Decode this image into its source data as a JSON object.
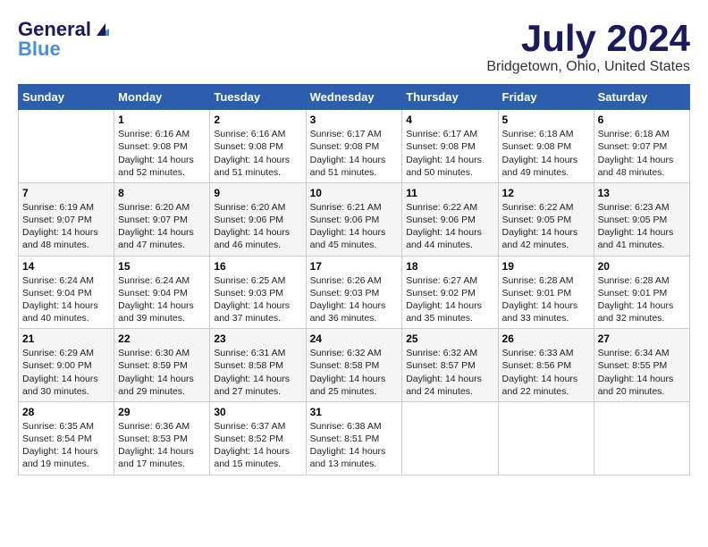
{
  "logo": {
    "general": "General",
    "blue": "Blue"
  },
  "title": "July 2024",
  "location": "Bridgetown, Ohio, United States",
  "days_of_week": [
    "Sunday",
    "Monday",
    "Tuesday",
    "Wednesday",
    "Thursday",
    "Friday",
    "Saturday"
  ],
  "weeks": [
    [
      {
        "day": "",
        "info": ""
      },
      {
        "day": "1",
        "info": "Sunrise: 6:16 AM\nSunset: 9:08 PM\nDaylight: 14 hours\nand 52 minutes."
      },
      {
        "day": "2",
        "info": "Sunrise: 6:16 AM\nSunset: 9:08 PM\nDaylight: 14 hours\nand 51 minutes."
      },
      {
        "day": "3",
        "info": "Sunrise: 6:17 AM\nSunset: 9:08 PM\nDaylight: 14 hours\nand 51 minutes."
      },
      {
        "day": "4",
        "info": "Sunrise: 6:17 AM\nSunset: 9:08 PM\nDaylight: 14 hours\nand 50 minutes."
      },
      {
        "day": "5",
        "info": "Sunrise: 6:18 AM\nSunset: 9:08 PM\nDaylight: 14 hours\nand 49 minutes."
      },
      {
        "day": "6",
        "info": "Sunrise: 6:18 AM\nSunset: 9:07 PM\nDaylight: 14 hours\nand 48 minutes."
      }
    ],
    [
      {
        "day": "7",
        "info": "Sunrise: 6:19 AM\nSunset: 9:07 PM\nDaylight: 14 hours\nand 48 minutes."
      },
      {
        "day": "8",
        "info": "Sunrise: 6:20 AM\nSunset: 9:07 PM\nDaylight: 14 hours\nand 47 minutes."
      },
      {
        "day": "9",
        "info": "Sunrise: 6:20 AM\nSunset: 9:06 PM\nDaylight: 14 hours\nand 46 minutes."
      },
      {
        "day": "10",
        "info": "Sunrise: 6:21 AM\nSunset: 9:06 PM\nDaylight: 14 hours\nand 45 minutes."
      },
      {
        "day": "11",
        "info": "Sunrise: 6:22 AM\nSunset: 9:06 PM\nDaylight: 14 hours\nand 44 minutes."
      },
      {
        "day": "12",
        "info": "Sunrise: 6:22 AM\nSunset: 9:05 PM\nDaylight: 14 hours\nand 42 minutes."
      },
      {
        "day": "13",
        "info": "Sunrise: 6:23 AM\nSunset: 9:05 PM\nDaylight: 14 hours\nand 41 minutes."
      }
    ],
    [
      {
        "day": "14",
        "info": "Sunrise: 6:24 AM\nSunset: 9:04 PM\nDaylight: 14 hours\nand 40 minutes."
      },
      {
        "day": "15",
        "info": "Sunrise: 6:24 AM\nSunset: 9:04 PM\nDaylight: 14 hours\nand 39 minutes."
      },
      {
        "day": "16",
        "info": "Sunrise: 6:25 AM\nSunset: 9:03 PM\nDaylight: 14 hours\nand 37 minutes."
      },
      {
        "day": "17",
        "info": "Sunrise: 6:26 AM\nSunset: 9:03 PM\nDaylight: 14 hours\nand 36 minutes."
      },
      {
        "day": "18",
        "info": "Sunrise: 6:27 AM\nSunset: 9:02 PM\nDaylight: 14 hours\nand 35 minutes."
      },
      {
        "day": "19",
        "info": "Sunrise: 6:28 AM\nSunset: 9:01 PM\nDaylight: 14 hours\nand 33 minutes."
      },
      {
        "day": "20",
        "info": "Sunrise: 6:28 AM\nSunset: 9:01 PM\nDaylight: 14 hours\nand 32 minutes."
      }
    ],
    [
      {
        "day": "21",
        "info": "Sunrise: 6:29 AM\nSunset: 9:00 PM\nDaylight: 14 hours\nand 30 minutes."
      },
      {
        "day": "22",
        "info": "Sunrise: 6:30 AM\nSunset: 8:59 PM\nDaylight: 14 hours\nand 29 minutes."
      },
      {
        "day": "23",
        "info": "Sunrise: 6:31 AM\nSunset: 8:58 PM\nDaylight: 14 hours\nand 27 minutes."
      },
      {
        "day": "24",
        "info": "Sunrise: 6:32 AM\nSunset: 8:58 PM\nDaylight: 14 hours\nand 25 minutes."
      },
      {
        "day": "25",
        "info": "Sunrise: 6:32 AM\nSunset: 8:57 PM\nDaylight: 14 hours\nand 24 minutes."
      },
      {
        "day": "26",
        "info": "Sunrise: 6:33 AM\nSunset: 8:56 PM\nDaylight: 14 hours\nand 22 minutes."
      },
      {
        "day": "27",
        "info": "Sunrise: 6:34 AM\nSunset: 8:55 PM\nDaylight: 14 hours\nand 20 minutes."
      }
    ],
    [
      {
        "day": "28",
        "info": "Sunrise: 6:35 AM\nSunset: 8:54 PM\nDaylight: 14 hours\nand 19 minutes."
      },
      {
        "day": "29",
        "info": "Sunrise: 6:36 AM\nSunset: 8:53 PM\nDaylight: 14 hours\nand 17 minutes."
      },
      {
        "day": "30",
        "info": "Sunrise: 6:37 AM\nSunset: 8:52 PM\nDaylight: 14 hours\nand 15 minutes."
      },
      {
        "day": "31",
        "info": "Sunrise: 6:38 AM\nSunset: 8:51 PM\nDaylight: 14 hours\nand 13 minutes."
      },
      {
        "day": "",
        "info": ""
      },
      {
        "day": "",
        "info": ""
      },
      {
        "day": "",
        "info": ""
      }
    ]
  ]
}
